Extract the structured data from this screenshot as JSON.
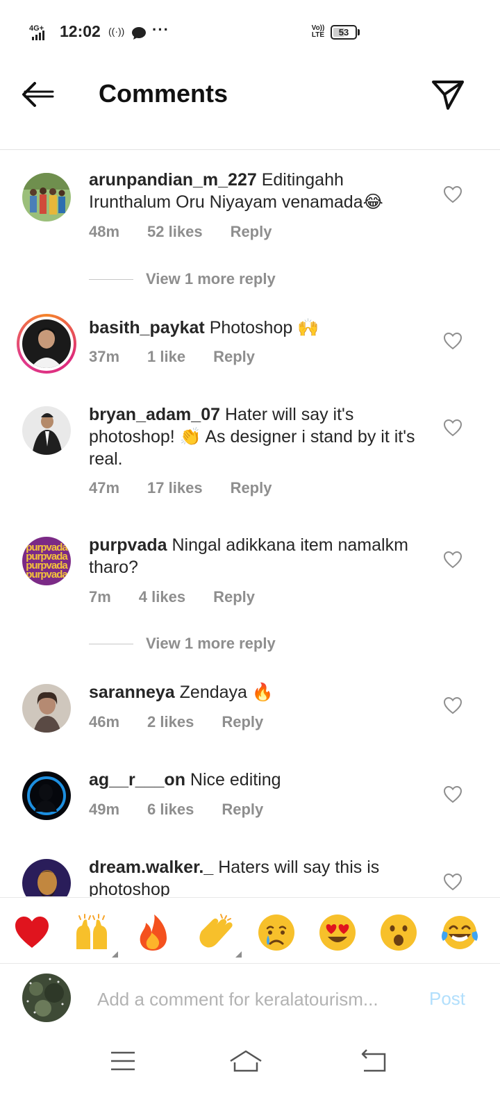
{
  "status_bar": {
    "network": "4G+",
    "time": "12:02",
    "volte": "Vo)) LTE",
    "battery": "53",
    "battery_level": 0.53,
    "icons": [
      "signal-icon",
      "hotspot-icon",
      "chat-notification-icon",
      "more-notifications-icon",
      "volte-icon",
      "battery-icon"
    ]
  },
  "header": {
    "title": "Comments",
    "back_icon": "back-arrow-icon",
    "share_icon": "send-icon"
  },
  "comments": [
    {
      "username": "arunpandian_m_227",
      "text": "Editingahh Irunthalum Oru Niyayam venamada😂",
      "time": "48m",
      "likes": "52 likes",
      "reply": "Reply",
      "view_more": "View 1 more reply"
    },
    {
      "username": "basith_paykat",
      "text": "Photoshop 🙌",
      "time": "37m",
      "likes": "1 like",
      "reply": "Reply"
    },
    {
      "username": "bryan_adam_07",
      "text": "Hater will say it's photoshop! 👏 As designer i stand by it it's real.",
      "time": "47m",
      "likes": "17 likes",
      "reply": "Reply"
    },
    {
      "username": "purpvada",
      "text": "Ningal adikkana item namalkm tharo?",
      "time": "7m",
      "likes": "4 likes",
      "reply": "Reply",
      "view_more": "View 1 more reply",
      "avatar_text": "purpvada"
    },
    {
      "username": "saranneya",
      "text": "Zendaya 🔥",
      "time": "46m",
      "likes": "2 likes",
      "reply": "Reply"
    },
    {
      "username": "ag__r___on",
      "text": "Nice editing",
      "time": "49m",
      "likes": "6 likes",
      "reply": "Reply"
    },
    {
      "username": "dream.walker._",
      "text": "Haters will say this is photoshop"
    }
  ],
  "reactions": [
    {
      "emoji": "❤️",
      "name": "heart"
    },
    {
      "emoji": "🙌",
      "name": "raising-hands"
    },
    {
      "emoji": "🔥",
      "name": "fire"
    },
    {
      "emoji": "👏",
      "name": "clapping-hands"
    },
    {
      "emoji": "😢",
      "name": "crying-face"
    },
    {
      "emoji": "😍",
      "name": "heart-eyes"
    },
    {
      "emoji": "😮",
      "name": "surprised-face"
    },
    {
      "emoji": "😂",
      "name": "tears-of-joy"
    }
  ],
  "input": {
    "placeholder": "Add a comment for keralatourism...",
    "value": "",
    "post_label": "Post"
  },
  "nav_bar": {
    "icons": [
      "menu-icon",
      "home-icon",
      "back-nav-icon"
    ]
  },
  "colors": {
    "text": "#262626",
    "secondary": "#8e8e8e",
    "post_disabled": "#b2dffc",
    "heart": "#ed4956"
  }
}
